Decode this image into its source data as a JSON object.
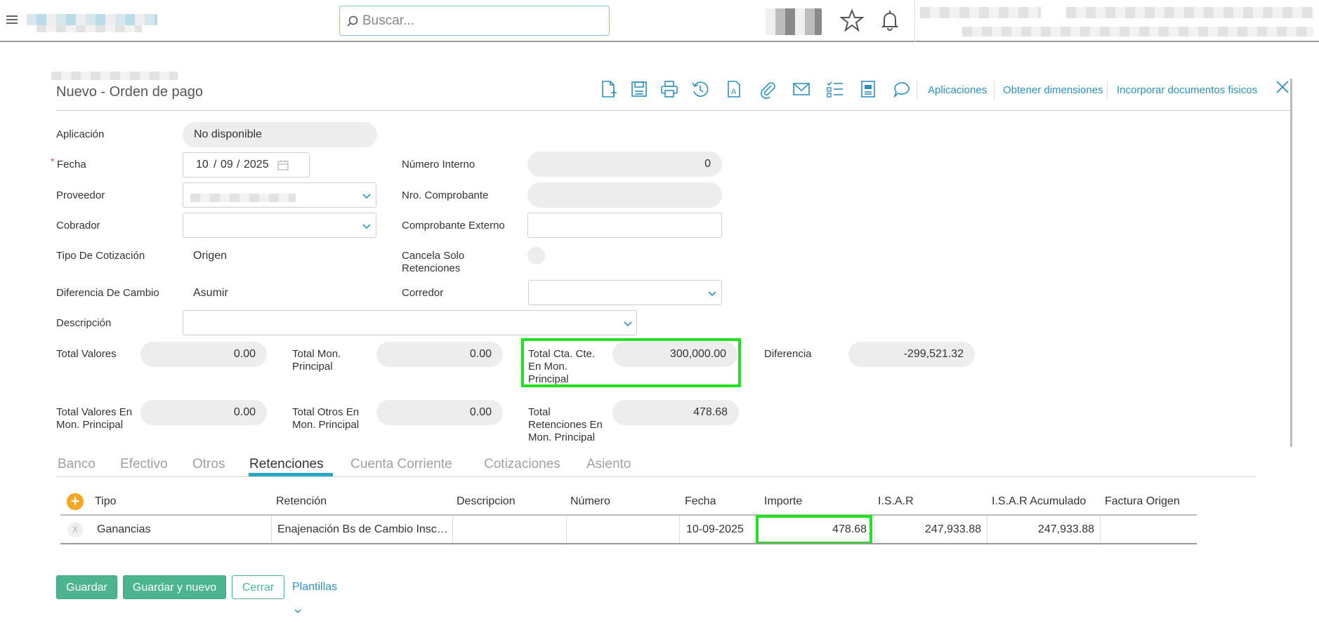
{
  "header": {
    "search_placeholder": "Buscar..."
  },
  "page": {
    "title": "Nuevo - Orden de pago",
    "toolbar_links": [
      "Aplicaciones",
      "Obtener dimensiones",
      "Incorporar documentos fisicos"
    ]
  },
  "form": {
    "aplicacion_label": "Aplicación",
    "aplicacion_value": "No disponible",
    "fecha_label": "Fecha",
    "fecha_required_mark": "*",
    "fecha_day": "10",
    "fecha_month": "09",
    "fecha_year": "2025",
    "proveedor_label": "Proveedor",
    "cobrador_label": "Cobrador",
    "tipo_cotizacion_label": "Tipo De Cotización",
    "tipo_cotizacion_value": "Origen",
    "diferencia_cambio_label": "Diferencia De Cambio",
    "diferencia_cambio_value": "Asumir",
    "descripcion_label": "Descripción",
    "numero_interno_label": "Número Interno",
    "numero_interno_value": "0",
    "nro_comprobante_label": "Nro. Comprobante",
    "comprobante_externo_label": "Comprobante Externo",
    "cancela_solo_retenciones_label": "Cancela Solo Retenciones",
    "corredor_label": "Corredor"
  },
  "totals": {
    "total_valores_label": "Total Valores",
    "total_valores_value": "0.00",
    "total_mon_principal_label": "Total Mon. Principal",
    "total_mon_principal_value": "0.00",
    "total_cta_cte_label": "Total Cta. Cte. En Mon. Principal",
    "total_cta_cte_value": "300,000.00",
    "diferencia_label": "Diferencia",
    "diferencia_value": "-299,521.32",
    "total_valores_mon_label": "Total Valores En Mon. Principal",
    "total_valores_mon_value": "0.00",
    "total_otros_label": "Total Otros En Mon. Principal",
    "total_otros_value": "0.00",
    "total_retenciones_label": "Total Retenciones En Mon. Principal",
    "total_retenciones_value": "478.68"
  },
  "tabs": [
    "Banco",
    "Efectivo",
    "Otros",
    "Retenciones",
    "Cuenta Corriente",
    "Cotizaciones",
    "Asiento"
  ],
  "active_tab": "Retenciones",
  "table": {
    "add_symbol": "+",
    "delete_symbol": "X",
    "columns": [
      "Tipo",
      "Retención",
      "Descripcion",
      "Número",
      "Fecha",
      "Importe",
      "I.S.A.R",
      "I.S.A.R Acumulado",
      "Factura Origen"
    ],
    "rows": [
      {
        "tipo": "Ganancias",
        "retencion": "Enajenación Bs de Cambio Insc…",
        "descripcion": "",
        "numero": "",
        "fecha": "10-09-2025",
        "importe": "478.68",
        "isar": "247,933.88",
        "isar_acumulado": "247,933.88",
        "factura_origen": ""
      }
    ]
  },
  "buttons": {
    "guardar": "Guardar",
    "guardar_nuevo": "Guardar y nuevo",
    "cerrar": "Cerrar",
    "plantillas": "Plantillas"
  },
  "colors": {
    "accent_blue": "#2f8fbd",
    "tab_underline": "#2aa7c4",
    "button_green": "#4cb58f",
    "highlight_green": "#22e022",
    "add_orange": "#f5a623"
  }
}
